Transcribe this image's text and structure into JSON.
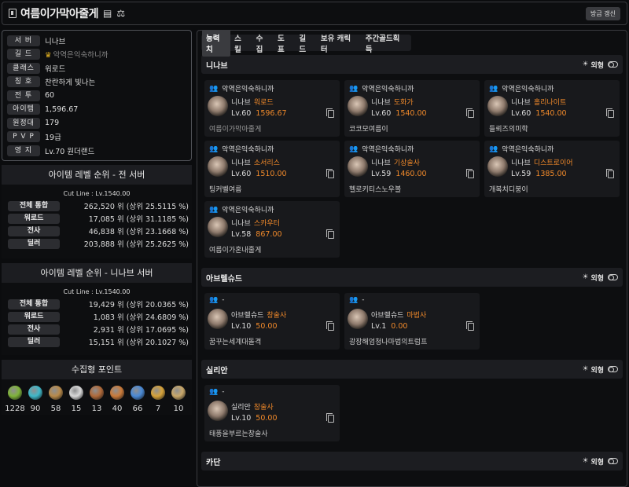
{
  "header": {
    "title": "여름이가막아줄게",
    "icons": [
      "id-card-icon",
      "scale-icon"
    ],
    "refresh_label": "방금 갱신"
  },
  "info": [
    {
      "key": "서 버",
      "value": "니나브"
    },
    {
      "key": "길 드",
      "value": "악역은익숙하니까",
      "crown": "crown-icon"
    },
    {
      "key": "클래스",
      "value": "워로드"
    },
    {
      "key": "칭 호",
      "value": "찬란하게 빛나는"
    },
    {
      "key": "전 투",
      "value": "60"
    },
    {
      "key": "아이템",
      "value": "1,596.67"
    },
    {
      "key": "원정대",
      "value": "179"
    },
    {
      "key": "P V P",
      "value": "19급"
    },
    {
      "key": "영 지",
      "value": "Lv.70 원더랜드"
    }
  ],
  "rank_all": {
    "title": "아이템 레벨 순위 - 전 서버",
    "cut": "Cut Line : Lv.1540.00",
    "rows": [
      {
        "key": "전체 통합",
        "value": "262,520 위 (상위 25.5115 %)"
      },
      {
        "key": "워로드",
        "value": "17,085 위 (상위 31.1185 %)"
      },
      {
        "key": "전사",
        "value": "46,838 위 (상위 23.1668 %)"
      },
      {
        "key": "딜러",
        "value": "203,888 위 (상위 25.2625 %)"
      }
    ]
  },
  "rank_server": {
    "title": "아이템 레벨 순위 - 니나브 서버",
    "cut": "Cut Line : Lv.1540.00",
    "rows": [
      {
        "key": "전체 통합",
        "value": "19,429 위 (상위 20.0365 %)"
      },
      {
        "key": "워로드",
        "value": "1,083 위 (상위 24.6809 %)"
      },
      {
        "key": "전사",
        "value": "2,931 위 (상위 17.0695 %)"
      },
      {
        "key": "딜러",
        "value": "15,151 위 (상위 20.1027 %)"
      }
    ]
  },
  "collect": {
    "title": "수집형 포인트",
    "items": [
      {
        "icon": "mokoko-seed-icon",
        "value": "1228",
        "color": "#7fb33a"
      },
      {
        "icon": "island-heart-icon",
        "value": "90",
        "color": "#3fb8c9"
      },
      {
        "icon": "great-picture-icon",
        "value": "58",
        "color": "#b88a4a"
      },
      {
        "icon": "giant-heart-icon",
        "value": "15",
        "color": "#d8d8d8"
      },
      {
        "icon": "ignea-token-icon",
        "value": "13",
        "color": "#b06a3a"
      },
      {
        "icon": "orpheus-star-icon",
        "value": "40",
        "color": "#c97a3a"
      },
      {
        "icon": "sea-bounty-icon",
        "value": "66",
        "color": "#4a8ad6"
      },
      {
        "icon": "world-tree-leaf-icon",
        "value": "7",
        "color": "#d6a23a"
      },
      {
        "icon": "omnium-star-icon",
        "value": "10",
        "color": "#c9a86a"
      }
    ]
  },
  "tabs": [
    "능력치",
    "스킬",
    "수집",
    "도표",
    "길드",
    "보유 캐릭터",
    "주간골드획득"
  ],
  "toggle_label": "외형",
  "servers": [
    {
      "name": "니나브",
      "chars": [
        {
          "guild": "악역은익숙하니까",
          "server": "니나브",
          "cls": "워로드",
          "lv": "Lv.60",
          "il": "1596.67",
          "name": "여름이가막아줄게",
          "dim": true
        },
        {
          "guild": "악역은익숙하니까",
          "server": "니나브",
          "cls": "도화가",
          "lv": "Lv.60",
          "il": "1540.00",
          "name": "코코모여름이"
        },
        {
          "guild": "악역은익숙하니까",
          "server": "니나브",
          "cls": "홀리나이트",
          "lv": "Lv.60",
          "il": "1540.00",
          "name": "들뢰즈의미학"
        },
        {
          "guild": "악역은익숙하니까",
          "server": "니나브",
          "cls": "소서리스",
          "lv": "Lv.60",
          "il": "1510.00",
          "name": "팅커벨여름"
        },
        {
          "guild": "악역은익숙하니까",
          "server": "니나브",
          "cls": "기상술사",
          "lv": "Lv.59",
          "il": "1460.00",
          "name": "헬로키티스노우볼"
        },
        {
          "guild": "악역은익숙하니까",
          "server": "니나브",
          "cls": "디스트로이어",
          "lv": "Lv.59",
          "il": "1385.00",
          "name": "개복치디붕이"
        },
        {
          "guild": "악역은익숙하니까",
          "server": "니나브",
          "cls": "스카우터",
          "lv": "Lv.58",
          "il": "867.00",
          "name": "여름이가혼내줄게"
        }
      ]
    },
    {
      "name": "아브렐슈드",
      "chars": [
        {
          "guild": "-",
          "server": "아브렐슈드",
          "cls": "창술사",
          "lv": "Lv.10",
          "il": "50.00",
          "name": "꿈꾸는세계대돌격"
        },
        {
          "guild": "-",
          "server": "아브렐슈드",
          "cls": "마법사",
          "lv": "Lv.1",
          "il": "0.00",
          "name": "광장해엄청나마법의트럼프"
        }
      ]
    },
    {
      "name": "실리안",
      "chars": [
        {
          "guild": "-",
          "server": "실리안",
          "cls": "창술사",
          "lv": "Lv.10",
          "il": "50.00",
          "name": "태풍을부르는창술사"
        }
      ]
    },
    {
      "name": "카단",
      "chars": []
    }
  ]
}
